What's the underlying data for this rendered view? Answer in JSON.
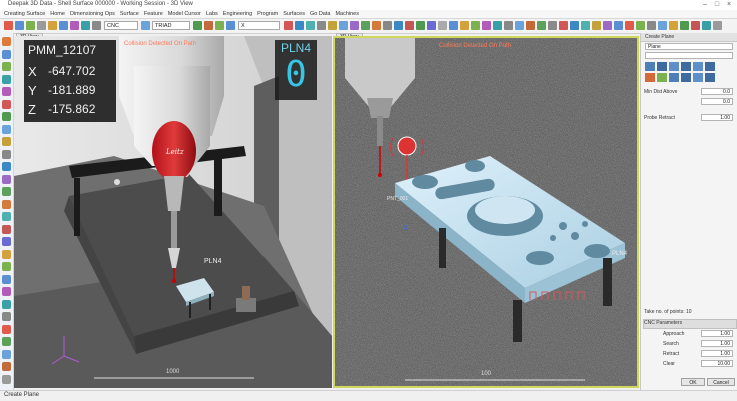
{
  "window": {
    "title": "Deepak 3D Data - Shell Surface 000000 - Working Session - 3D View"
  },
  "menu": [
    "Creating Surface",
    "Home",
    "Dimensioning Ops",
    "Surface",
    "Feature",
    "Model Cursor",
    "Labs",
    "Engineering",
    "Program",
    "Surfaces",
    "Go Data",
    "Machines"
  ],
  "toolbar": {
    "combo1": "CNC",
    "combo2": "TRIAD",
    "combo3": "X"
  },
  "viewport_left": {
    "tab": "3D View",
    "machine_name": "PMM_12107",
    "axes": [
      {
        "label": "X",
        "value": "-647.702"
      },
      {
        "label": "Y",
        "value": "-181.889"
      },
      {
        "label": "Z",
        "value": "-175.862"
      }
    ],
    "plane_name": "PLN4",
    "plane_count": "0",
    "collision_text": "Collision Detected On Path",
    "part_label": "PLN4",
    "scale_label": "1000",
    "probe_brand": "Leitz"
  },
  "viewport_right": {
    "tab": "3D View",
    "collision_text": "Collision Detected On Path",
    "part_label": "PLN4",
    "point_label": "PNT_001",
    "scale_label": "100"
  },
  "right_panel": {
    "header": "Create Plane",
    "dropdown1": "Plane",
    "dropdown2": "",
    "field1_label": "Min Dist Above",
    "field1_value": "0.0",
    "field2_label": "",
    "field2_value": "0.0",
    "field3_label": "Probe Retract",
    "field3_value": "1.00",
    "take_points_label": "Take no. of points: 10",
    "section_label": "CNC Parameters",
    "params": [
      {
        "label": "Approach",
        "value": "1.00"
      },
      {
        "label": "Search",
        "value": "1.00"
      },
      {
        "label": "Retract",
        "value": "1.00"
      },
      {
        "label": "Clear",
        "value": "10.00"
      }
    ],
    "ok_label": "OK",
    "cancel_label": "Cancel"
  },
  "status": {
    "text": "Create Plane"
  },
  "colors": {
    "accent_active_viewport": "#cfd85a",
    "collision": "#ff7b55",
    "pln_digit": "#36c6e6"
  }
}
